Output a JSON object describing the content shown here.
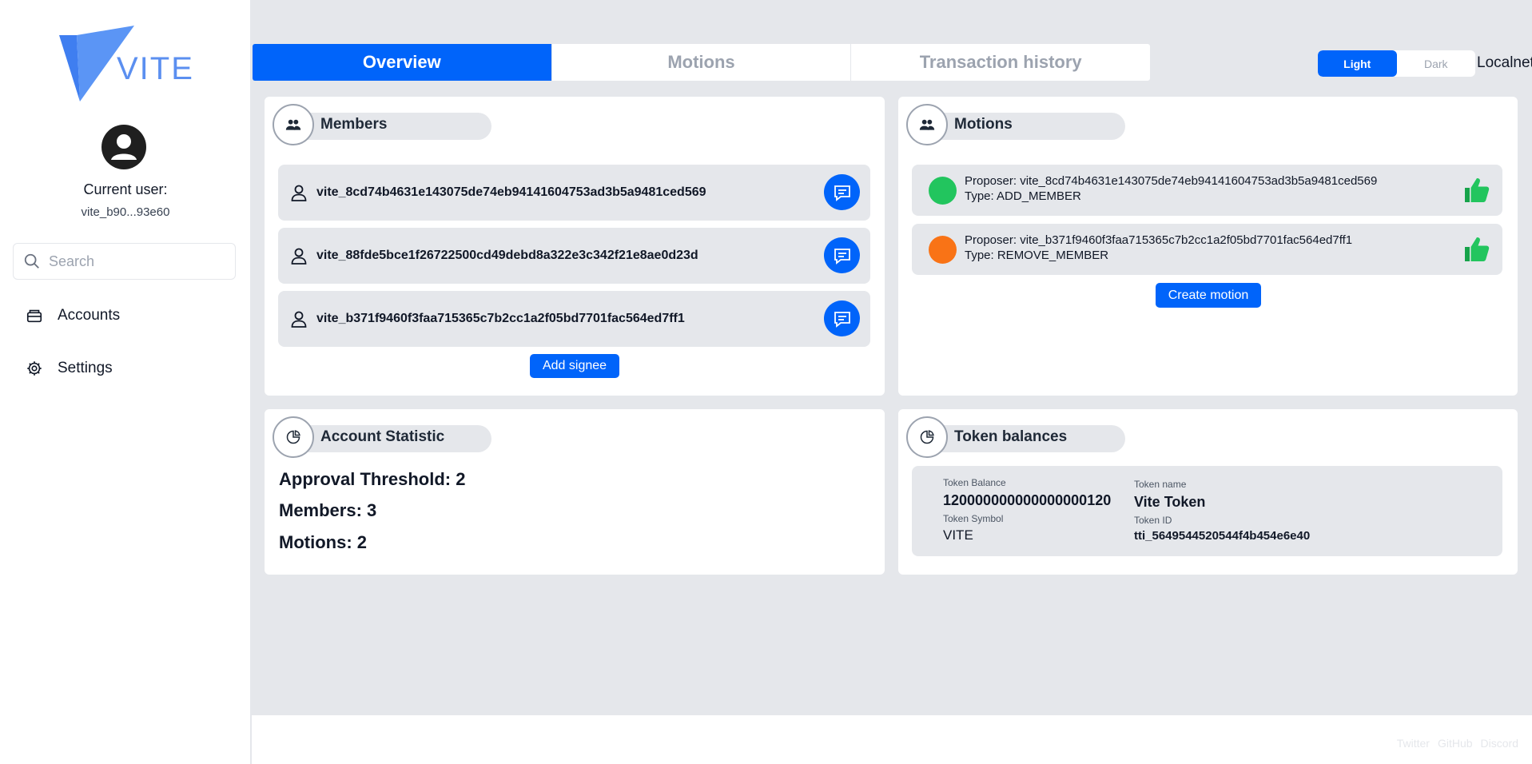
{
  "sidebar": {
    "logo_text": "VITE",
    "current_user_label": "Current user:",
    "current_user_address": "vite_b90...93e60",
    "search_placeholder": "Search",
    "nav": [
      {
        "label": "Accounts",
        "icon": "wallet-icon"
      },
      {
        "label": "Settings",
        "icon": "gear-icon"
      }
    ]
  },
  "tabs": [
    {
      "label": "Overview",
      "active": true
    },
    {
      "label": "Motions",
      "active": false
    },
    {
      "label": "Transaction history",
      "active": false
    }
  ],
  "theme": {
    "light": "Light",
    "dark": "Dark",
    "selected": "Light"
  },
  "network": "Localnet",
  "members_card": {
    "title": "Members",
    "members": [
      "vite_8cd74b4631e143075de74eb94141604753ad3b5a9481ced569",
      "vite_88fde5bce1f26722500cd49debd8a322e3c342f21e8ae0d23d",
      "vite_b371f9460f3faa715365c7b2cc1a2f05bd7701fac564ed7ff1"
    ],
    "add_button": "Add signee"
  },
  "motions_card": {
    "title": "Motions",
    "motions": [
      {
        "proposer": "Proposer: vite_8cd74b4631e143075de74eb94141604753ad3b5a9481ced569",
        "type": "Type: ADD_MEMBER",
        "color": "#22c55e"
      },
      {
        "proposer": "Proposer: vite_b371f9460f3faa715365c7b2cc1a2f05bd7701fac564ed7ff1",
        "type": "Type: REMOVE_MEMBER",
        "color": "#f97316"
      }
    ],
    "create_button": "Create motion"
  },
  "stats_card": {
    "title": "Account Statistic",
    "threshold": "Approval Threshold: 2",
    "members": "Members: 3",
    "motions": "Motions: 2"
  },
  "tokens_card": {
    "title": "Token balances",
    "balance_label": "Token Balance",
    "balance_value": "120000000000000000120",
    "symbol_label": "Token Symbol",
    "symbol_value": "VITE",
    "name_label": "Token name",
    "name_value": "Vite Token",
    "id_label": "Token ID",
    "id_value": "tti_5649544520544f4b454e6e40"
  },
  "footer": {
    "twitter": "Twitter",
    "github": "GitHub",
    "discord": "Discord"
  },
  "colors": {
    "accent": "#0064fa",
    "like": "#22c55e",
    "background": "#e5e7eb"
  }
}
